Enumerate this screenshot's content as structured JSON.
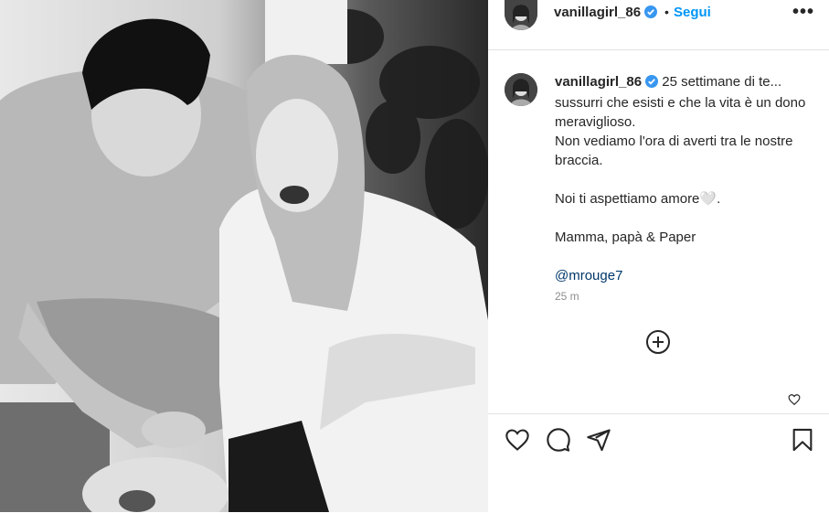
{
  "post": {
    "photo_alt": "photo",
    "username": "vanillagirl_86",
    "follow_label": "Segui",
    "separator": "•",
    "more_label": "•••",
    "caption": {
      "username": "vanillagirl_86",
      "line1": "25 settimane di te...",
      "line2": "sussurri che esisti e che la vita è un dono meraviglioso.",
      "line3": "Non vediamo l'ora di averti tra le nostre braccia.",
      "line4": "Noi ti aspettiamo amore🤍.",
      "line5": "Mamma, papà & Paper",
      "mention": "@mrouge7"
    },
    "timestamp": "25 m"
  },
  "icons": {
    "verified": "verified-badge-icon",
    "more": "more-options-icon",
    "plus": "load-more-comments-icon",
    "like_small": "heart-icon",
    "like": "heart-icon",
    "comment": "comment-icon",
    "share": "share-icon",
    "save": "bookmark-icon"
  },
  "colors": {
    "accent": "#0095f6",
    "verified": "#3897f0",
    "text": "#262626",
    "muted": "#8e8e8e"
  }
}
